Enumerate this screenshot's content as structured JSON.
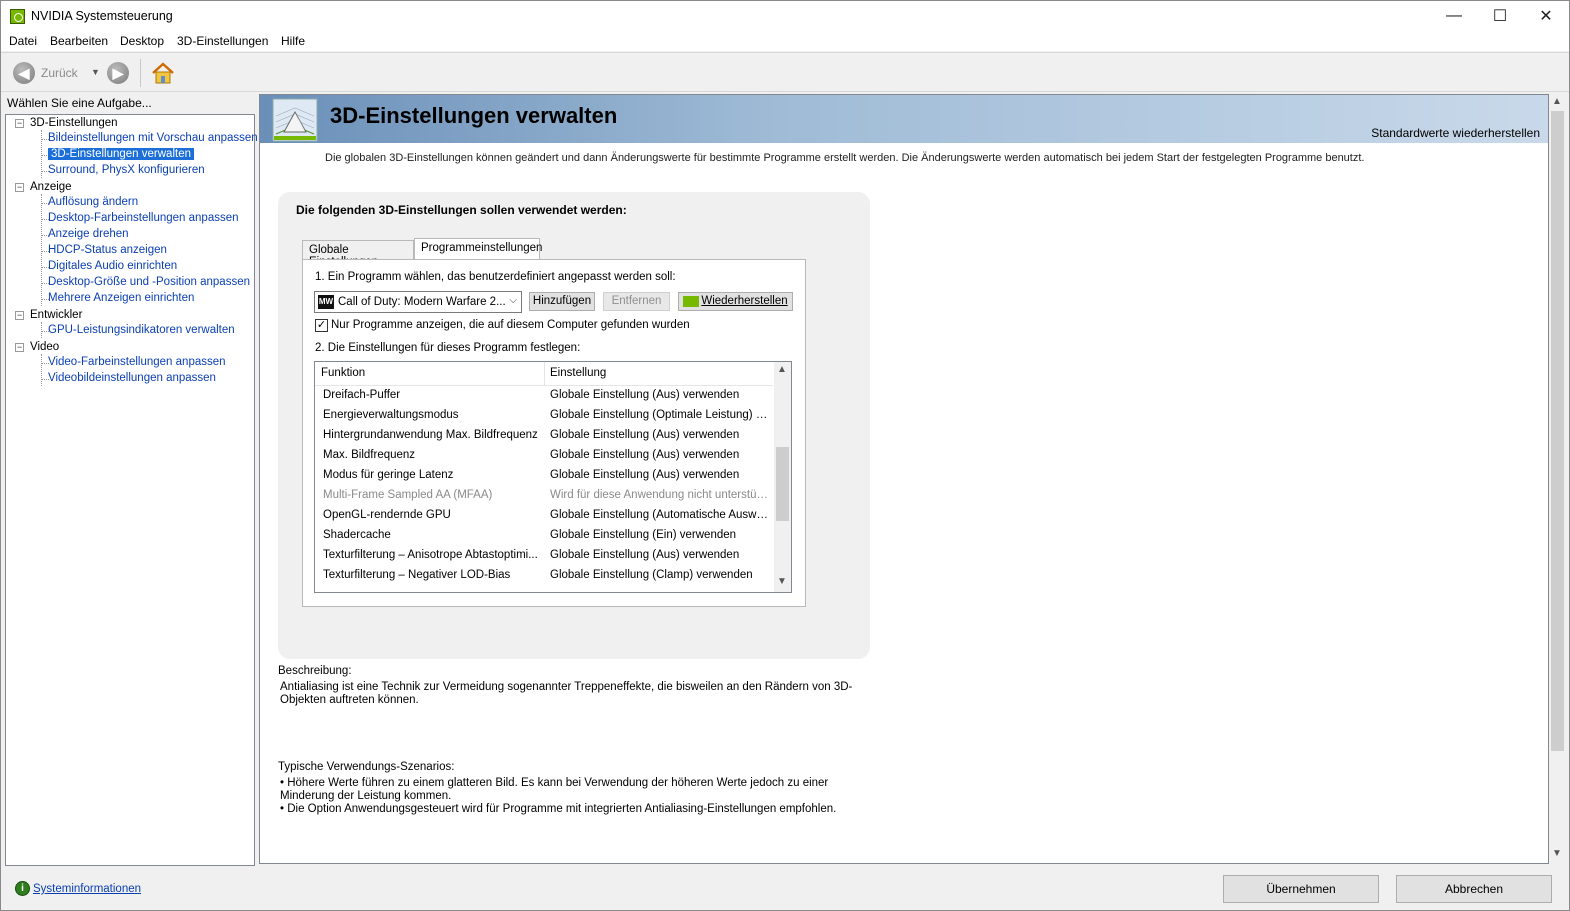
{
  "window": {
    "title": "NVIDIA Systemsteuerung",
    "minimize": "—",
    "maximize": "☐",
    "close": "✕"
  },
  "menu": [
    "Datei",
    "Bearbeiten",
    "Desktop",
    "3D-Einstellungen",
    "Hilfe"
  ],
  "toolbar": {
    "back_label": "Zurück",
    "back_icon": "arrow-left-icon",
    "forward_icon": "arrow-right-icon",
    "home_icon": "home-icon"
  },
  "sidebar": {
    "header": "Wählen Sie eine Aufgabe...",
    "groups": [
      {
        "label": "3D-Einstellungen",
        "items": [
          "Bildeinstellungen mit Vorschau anpassen",
          "3D-Einstellungen verwalten",
          "Surround, PhysX konfigurieren"
        ]
      },
      {
        "label": "Anzeige",
        "items": [
          "Auflösung ändern",
          "Desktop-Farbeinstellungen anpassen",
          "Anzeige drehen",
          "HDCP-Status anzeigen",
          "Digitales Audio einrichten",
          "Desktop-Größe und -Position anpassen",
          "Mehrere Anzeigen einrichten"
        ]
      },
      {
        "label": "Entwickler",
        "items": [
          "GPU-Leistungsindikatoren verwalten"
        ]
      },
      {
        "label": "Video",
        "items": [
          "Video-Farbeinstellungen anpassen",
          "Videobildeinstellungen anpassen"
        ]
      }
    ],
    "selected": "3D-Einstellungen verwalten"
  },
  "main": {
    "title": "3D-Einstellungen verwalten",
    "restore_defaults": "Standardwerte wiederherstellen",
    "intro": "Die globalen 3D-Einstellungen können geändert und dann Änderungswerte für bestimmte Programme erstellt werden. Die Änderungswerte werden automatisch bei jedem Start der festgelegten Programme benutzt.",
    "settings_heading": "Die folgenden 3D-Einstellungen sollen verwendet werden:",
    "tabs": [
      {
        "label": "Globale Einstellungen",
        "active": false
      },
      {
        "label": "Programmeinstellungen",
        "active": true
      }
    ],
    "step1": "1. Ein Programm wählen, das benutzerdefiniert angepasst werden soll:",
    "program": {
      "logo": "MW",
      "selected": "Call of Duty: Modern Warfare 2..."
    },
    "buttons": {
      "add": "Hinzufügen",
      "remove": "Entfernen",
      "restore": "Wiederherstellen"
    },
    "checkbox": {
      "checked": true,
      "mark": "✓",
      "label": "Nur Programme anzeigen, die auf diesem Computer gefunden wurden"
    },
    "step2": "2. Die Einstellungen für dieses Programm festlegen:",
    "grid": {
      "col_function": "Funktion",
      "col_setting": "Einstellung",
      "rows": [
        {
          "f": "Dreifach-Puffer",
          "s": "Globale Einstellung (Aus) verwenden",
          "dim": false
        },
        {
          "f": "Energieverwaltungsmodus",
          "s": "Globale Einstellung (Optimale Leistung) ver...",
          "dim": false
        },
        {
          "f": "Hintergrundanwendung Max. Bildfrequenz",
          "s": "Globale Einstellung (Aus) verwenden",
          "dim": false
        },
        {
          "f": "Max. Bildfrequenz",
          "s": "Globale Einstellung (Aus) verwenden",
          "dim": false
        },
        {
          "f": "Modus für geringe Latenz",
          "s": "Globale Einstellung (Aus) verwenden",
          "dim": false
        },
        {
          "f": "Multi-Frame Sampled AA (MFAA)",
          "s": "Wird für diese Anwendung nicht unterstützt",
          "dim": true
        },
        {
          "f": "OpenGL-rendernde GPU",
          "s": "Globale Einstellung (Automatische Auswahl...",
          "dim": false
        },
        {
          "f": "Shadercache",
          "s": "Globale Einstellung (Ein) verwenden",
          "dim": false
        },
        {
          "f": "Texturfilterung – Anisotrope Abtastoptimi...",
          "s": "Globale Einstellung (Aus) verwenden",
          "dim": false
        },
        {
          "f": "Texturfilterung – Negativer LOD-Bias",
          "s": "Globale Einstellung (Clamp) verwenden",
          "dim": false
        }
      ]
    },
    "description_label": "Beschreibung:",
    "description": "Antialiasing ist eine Technik zur Vermeidung sogenannter Treppeneffekte, die bisweilen an den Rändern von 3D-Objekten auftreten können.",
    "usage_label": "Typische Verwendungs-Szenarios:",
    "usage": [
      "• Höhere Werte führen zu einem glatteren Bild. Es kann bei Verwendung der höheren Werte jedoch zu einer Minderung der Leistung kommen.",
      "• Die Option Anwendungsgesteuert wird für Programme mit integrierten Antialiasing-Einstellungen empfohlen."
    ]
  },
  "footer": {
    "sysinfo": "Systeminformationen",
    "apply": "Übernehmen",
    "cancel": "Abbrechen"
  },
  "colors": {
    "nvidia_green": "#76b900",
    "selection_blue": "#1c6fd8",
    "link_blue": "#0a3fb0"
  }
}
